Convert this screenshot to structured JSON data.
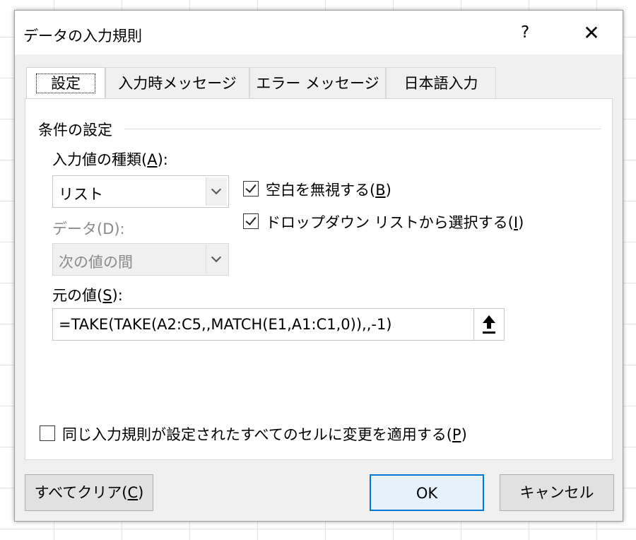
{
  "dialog": {
    "title": "データの入力規則",
    "help": "?",
    "close": "✕"
  },
  "tabs": [
    {
      "label": "設定"
    },
    {
      "label": "入力時メッセージ"
    },
    {
      "label": "エラー メッセージ"
    },
    {
      "label": "日本語入力"
    }
  ],
  "settings": {
    "group_label": "条件の設定",
    "allow_label": "入力値の種類(",
    "allow_key": "A",
    "allow_suffix": "):",
    "allow_value": "リスト",
    "data_label": "データ(D):",
    "data_value": "次の値の間",
    "ignore_blank_text": "空白を無視する(",
    "ignore_blank_key": "B",
    "ignore_blank_suffix": ")",
    "ignore_blank_checked": true,
    "dropdown_text": "ドロップダウン リストから選択する(",
    "dropdown_key": "I",
    "dropdown_suffix": ")",
    "dropdown_checked": true,
    "source_label": "元の値(",
    "source_key": "S",
    "source_suffix": "):",
    "source_value": "=TAKE(TAKE(A2:C5,,MATCH(E1,A1:C1,0)),,-1)",
    "apply_all_text": "同じ入力規則が設定されたすべてのセルに変更を適用する(",
    "apply_all_key": "P",
    "apply_all_suffix": ")",
    "apply_all_checked": false
  },
  "buttons": {
    "clear_text": "すべてクリア(",
    "clear_key": "C",
    "clear_suffix": ")",
    "ok": "OK",
    "cancel": "キャンセル"
  },
  "icons": {
    "dropdown": "chevron-down-icon",
    "range_select": "arrow-up-icon",
    "check": "checkmark-icon"
  },
  "colors": {
    "accent": "#0078d7",
    "disabled_text": "#8a8a8a"
  }
}
